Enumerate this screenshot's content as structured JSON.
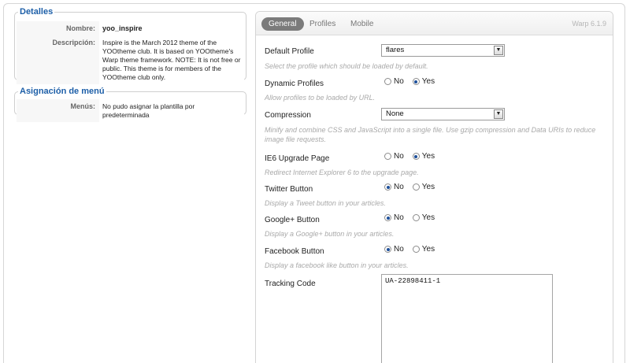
{
  "details": {
    "legend": "Detalles",
    "name_label": "Nombre:",
    "name_value": "yoo_inspire",
    "desc_label": "Descripción:",
    "desc_value": "Inspire is the March 2012 theme of the YOOtheme club. It is based on YOOtheme's Warp theme framework. NOTE: It is not free or public. This theme is for members of the YOOtheme club only."
  },
  "menu_assignment": {
    "legend": "Asignación de menú",
    "menus_label": "Menús:",
    "menus_value": "No pudo asignar la plantilla por predeterminada"
  },
  "tabs": {
    "general": "General",
    "profiles": "Profiles",
    "mobile": "Mobile",
    "version": "Warp 6.1.9"
  },
  "options": {
    "default_profile": {
      "label": "Default Profile",
      "value": "flares",
      "desc": "Select the profile which should be loaded by default."
    },
    "dynamic_profiles": {
      "label": "Dynamic Profiles",
      "no": "No",
      "yes": "Yes",
      "selected": "yes",
      "desc": "Allow profiles to be loaded by URL."
    },
    "compression": {
      "label": "Compression",
      "value": "None",
      "desc": "Minify and combine CSS and JavaScript into a single file. Use gzip compression and Data URIs to reduce image file requests."
    },
    "ie6_upgrade": {
      "label": "IE6 Upgrade Page",
      "no": "No",
      "yes": "Yes",
      "selected": "yes",
      "desc": "Redirect Internet Explorer 6 to the upgrade page."
    },
    "twitter": {
      "label": "Twitter Button",
      "no": "No",
      "yes": "Yes",
      "selected": "no",
      "desc": "Display a Tweet button in your articles."
    },
    "googleplus": {
      "label": "Google+ Button",
      "no": "No",
      "yes": "Yes",
      "selected": "no",
      "desc": "Display a Google+ button in your articles."
    },
    "facebook": {
      "label": "Facebook Button",
      "no": "No",
      "yes": "Yes",
      "selected": "no",
      "desc": "Display a facebook like button in your articles."
    },
    "tracking": {
      "label": "Tracking Code",
      "value": "UA-22898411-1"
    }
  },
  "colors": {
    "legend_blue": "#1d5fa8",
    "active_tab": "#7b7b7b"
  }
}
